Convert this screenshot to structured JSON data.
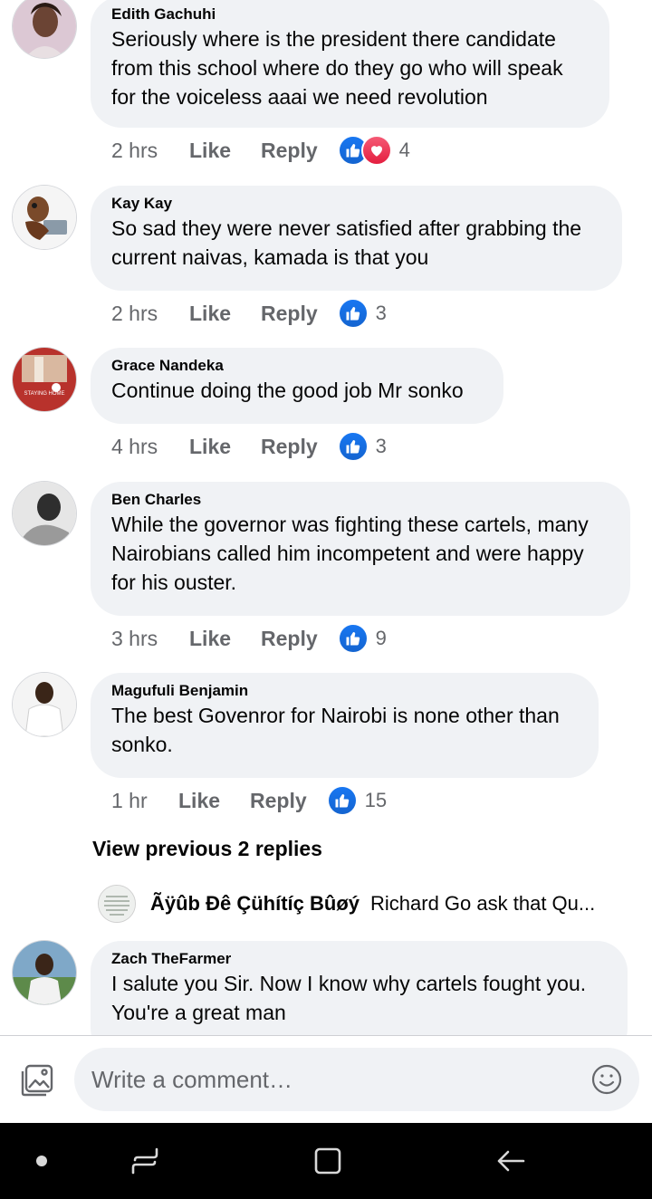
{
  "comments": [
    {
      "author": "Edith Gachuhi",
      "lines": [
        "Seriously where is the president there candidate",
        "from this school where do they go who will speak",
        "for the voiceless aaai we need revolution"
      ],
      "time": "2 hrs",
      "like_label": "Like",
      "reply_label": "Reply",
      "reactions": [
        "like",
        "love"
      ],
      "reaction_count": "4"
    },
    {
      "author": "Kay Kay",
      "lines": [
        "So sad they were never satisfied after grabbing the",
        "current naivas, kamada is that you"
      ],
      "time": "2 hrs",
      "like_label": "Like",
      "reply_label": "Reply",
      "reactions": [
        "like"
      ],
      "reaction_count": "3"
    },
    {
      "author": "Grace Nandeka",
      "lines": [
        "Continue doing the good job Mr sonko"
      ],
      "time": "4 hrs",
      "like_label": "Like",
      "reply_label": "Reply",
      "reactions": [
        "like"
      ],
      "reaction_count": "3",
      "avatar_text": "STAYING HOME"
    },
    {
      "author": "Ben Charles",
      "lines": [
        "While the governor was fighting these cartels, many",
        "Nairobians called him incompetent and were happy",
        "for his ouster."
      ],
      "time": "3 hrs",
      "like_label": "Like",
      "reply_label": "Reply",
      "reactions": [
        "like"
      ],
      "reaction_count": "9"
    },
    {
      "author": "Magufuli Benjamin",
      "lines": [
        "The best Govenror for Nairobi is none other than",
        "sonko."
      ],
      "time": "1 hr",
      "like_label": "Like",
      "reply_label": "Reply",
      "reactions": [
        "like"
      ],
      "reaction_count": "15"
    }
  ],
  "view_previous_replies": "View previous 2 replies",
  "reply_preview": {
    "author": "Ãÿûb Đê Çühítíç Bûøý",
    "text": "Richard Go ask that Qu..."
  },
  "partial_comment": {
    "author": "Zach TheFarmer",
    "lines": [
      "I salute you Sir. Now I know why cartels fought you.",
      "You're a great man"
    ]
  },
  "composer": {
    "placeholder": "Write a comment…",
    "photo_icon": "photo-icon",
    "emoji_icon": "emoji-icon"
  },
  "navbar": {
    "icons": [
      "dot-icon",
      "recent-apps-icon",
      "home-icon",
      "back-icon"
    ]
  },
  "colors": {
    "like_blue": "#1877f2",
    "love_red": "#f33e58",
    "bubble": "#f0f2f5",
    "meta_gray": "#65676b"
  }
}
